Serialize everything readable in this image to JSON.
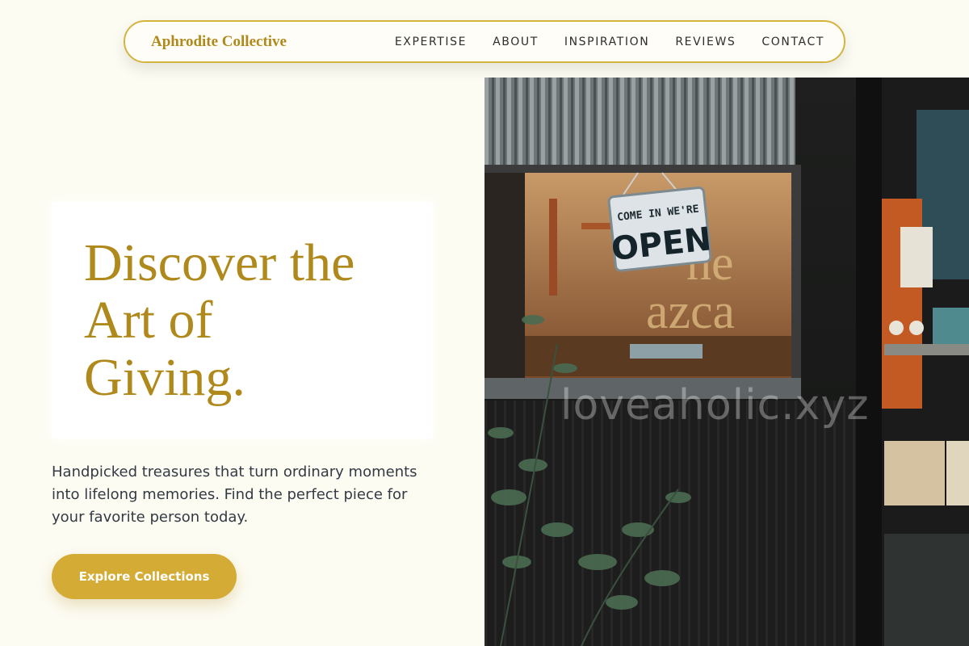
{
  "brand": {
    "name": "Aphrodite Collective"
  },
  "nav": {
    "items": [
      {
        "label": "EXPERTISE"
      },
      {
        "label": "ABOUT"
      },
      {
        "label": "INSPIRATION"
      },
      {
        "label": "REVIEWS"
      },
      {
        "label": "CONTACT"
      }
    ]
  },
  "hero": {
    "headline_line1": "Discover the",
    "headline_line2": "Art of",
    "headline_line3": "Giving.",
    "subtext": "Handpicked treasures that turn ordinary moments into lifelong memories. Find the perfect piece for your favorite person today.",
    "cta_label": "Explore Collections"
  },
  "image": {
    "sign_line1": "COME IN WE'RE",
    "sign_line2": "OPEN",
    "watermark": "loveaholic.xyz"
  },
  "colors": {
    "accent": "#b0891c",
    "button": "#d4ac35",
    "background": "#fdfcf3"
  }
}
